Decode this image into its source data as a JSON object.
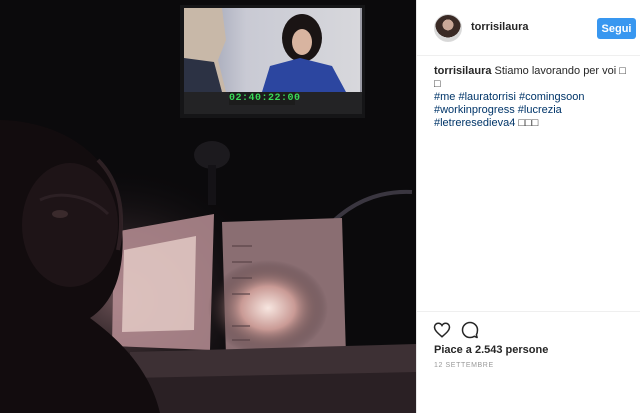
{
  "post": {
    "username": "torrisilaura",
    "follow_label": "Segui",
    "caption_username": "torrisilaura",
    "caption_text": "Stiamo lavorando per voi □ □",
    "hashtags": [
      "#me",
      "#lauratorrisi",
      "#comingsoon",
      "#workinprogress",
      "#lucrezia",
      "#letreresedieva4"
    ],
    "caption_tail": "□□□",
    "likes": "Piace a 2.543 persone",
    "date": "12 SETTEMBRE"
  },
  "photo": {
    "timecode": "02:40:22:00"
  },
  "icons": {
    "like": "heart-outline-icon",
    "comment": "speech-bubble-icon"
  },
  "colors": {
    "accent": "#3897f0",
    "hashtag": "#003569",
    "photo_dark": "#0b0a0c",
    "lamp_glow": "#e9c9c2"
  }
}
